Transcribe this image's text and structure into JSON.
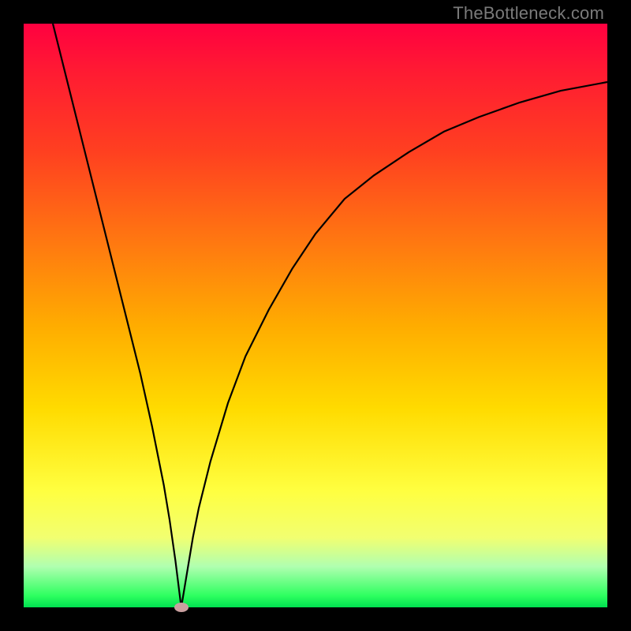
{
  "watermark": "TheBottleneck.com",
  "chart_data": {
    "type": "line",
    "title": "",
    "xlabel": "",
    "ylabel": "",
    "xlim": [
      0,
      100
    ],
    "ylim": [
      0,
      100
    ],
    "minimum_marker": {
      "x": 27,
      "y": 0
    },
    "series": [
      {
        "name": "curve",
        "x": [
          5,
          8,
          11,
          14,
          17,
          20,
          22,
          24,
          25,
          26,
          27,
          28,
          29,
          30,
          32,
          35,
          38,
          42,
          46,
          50,
          55,
          60,
          66,
          72,
          78,
          85,
          92,
          100
        ],
        "values": [
          100,
          88,
          76,
          64,
          52,
          40,
          31,
          21,
          15,
          8,
          0,
          6,
          12,
          17,
          25,
          35,
          43,
          51,
          58,
          64,
          70,
          74,
          78,
          81.5,
          84,
          86.5,
          88.5,
          90
        ]
      }
    ],
    "background_gradient": {
      "top": "#ff0040",
      "mid": "#ffdd00",
      "bottom": "#00e050"
    }
  }
}
